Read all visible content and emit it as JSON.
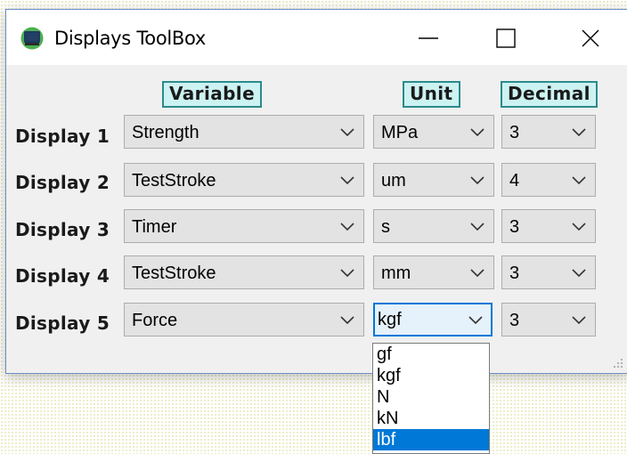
{
  "window": {
    "title": "Displays ToolBox",
    "icon": "monitor-icon",
    "controls": [
      "minimize-icon",
      "maximize-icon",
      "close-icon"
    ]
  },
  "headers": {
    "variable": "Variable",
    "unit": "Unit",
    "decimal": "Decimal"
  },
  "rows": [
    {
      "label": "Display 1",
      "variable": "Strength",
      "unit": "MPa",
      "decimal": "3"
    },
    {
      "label": "Display 2",
      "variable": "TestStroke",
      "unit": "um",
      "decimal": "4"
    },
    {
      "label": "Display 3",
      "variable": "Timer",
      "unit": "s",
      "decimal": "3"
    },
    {
      "label": "Display 4",
      "variable": "TestStroke",
      "unit": "mm",
      "decimal": "3"
    },
    {
      "label": "Display 5",
      "variable": "Force",
      "unit": "kgf",
      "decimal": "3"
    }
  ],
  "unit_dropdown": {
    "open_for": "Display 5",
    "options": [
      "gf",
      "kgf",
      "N",
      "kN",
      "lbf"
    ],
    "highlighted": "lbf"
  },
  "colors": {
    "header_fill": "#ccf2f2",
    "header_border": "#2c8a8a",
    "focus": "#0078d7",
    "highlight": "#0078d7"
  }
}
